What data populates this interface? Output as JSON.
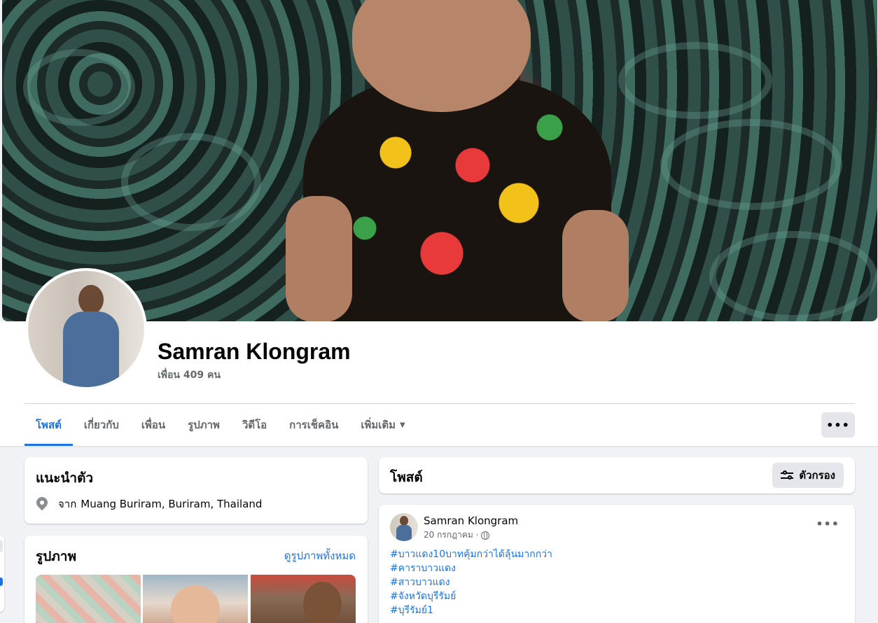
{
  "profile": {
    "name": "Samran Klongram",
    "friends_text": "เพื่อน 409 คน"
  },
  "tabs": [
    {
      "label": "โพสต์",
      "active": true
    },
    {
      "label": "เกี่ยวกับ"
    },
    {
      "label": "เพื่อน"
    },
    {
      "label": "รูปภาพ"
    },
    {
      "label": "วิดีโอ"
    },
    {
      "label": "การเช็คอิน"
    },
    {
      "label": "เพิ่มเติม"
    }
  ],
  "more_button": "•••",
  "intro": {
    "title": "แนะนำตัว",
    "location_prefix": "จาก",
    "location": "Muang Buriram, Buriram, Thailand"
  },
  "photos": {
    "title": "รูปภาพ",
    "see_all": "ดูรูปภาพทั้งหมด"
  },
  "posts": {
    "title": "โพสต์",
    "filter_label": "ตัวกรอง"
  },
  "post": {
    "author": "Samran Klongram",
    "date": "20 กรกฎาคม ·",
    "more": "•••",
    "hashtags": [
      "#บาวแดง10บาทคุ้มกว่าได้ลุ้นมากกว่า",
      "#คาราบาวแดง",
      "#สาวบาวแดง",
      "#จังหวัดบุรีรัมย์",
      "#บุรีรัมย์1"
    ]
  },
  "colors": {
    "accent": "#1b74e4",
    "secondary_text": "#65676b",
    "page_bg": "#f0f2f5",
    "button_bg": "#e4e6eb"
  }
}
